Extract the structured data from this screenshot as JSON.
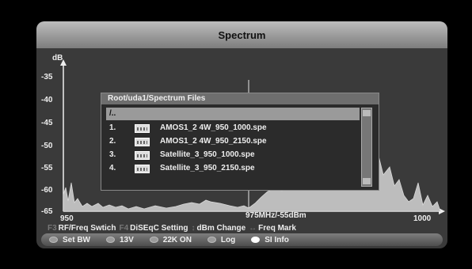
{
  "title": "Spectrum",
  "y_unit": "dB",
  "y_ticks": [
    "-35",
    "-40",
    "-45",
    "-50",
    "-55",
    "-60",
    "-65"
  ],
  "x_start": "950",
  "x_end": "1000",
  "marker_readout": "975MHz/-55dBm",
  "help": [
    {
      "key": "F3",
      "label": "RF/Freq Swtich"
    },
    {
      "key": "F4",
      "label": "DiSEqC Setting"
    },
    {
      "key": "↕",
      "label": "dBm Change"
    },
    {
      "key": "↔",
      "label": "Freq Mark"
    }
  ],
  "buttons": [
    {
      "label": "Set BW",
      "color": "#9a9a9a"
    },
    {
      "label": "13V",
      "color": "#9a9a9a"
    },
    {
      "label": "22K ON",
      "color": "#9a9a9a"
    },
    {
      "label": "Log",
      "color": "#9a9a9a"
    },
    {
      "label": "SI Info",
      "color": "#ffffff"
    }
  ],
  "dialog": {
    "title": "Root/uda1/Spectrum Files",
    "parent_entry": "/..",
    "files": [
      {
        "num": "1.",
        "name": "AMOS1_2 4W_950_1000.spe"
      },
      {
        "num": "2.",
        "name": "AMOS1_2 4W_950_2150.spe"
      },
      {
        "num": "3.",
        "name": "Satellite_3_950_1000.spe"
      },
      {
        "num": "4.",
        "name": "Satellite_3_950_2150.spe"
      }
    ]
  }
}
